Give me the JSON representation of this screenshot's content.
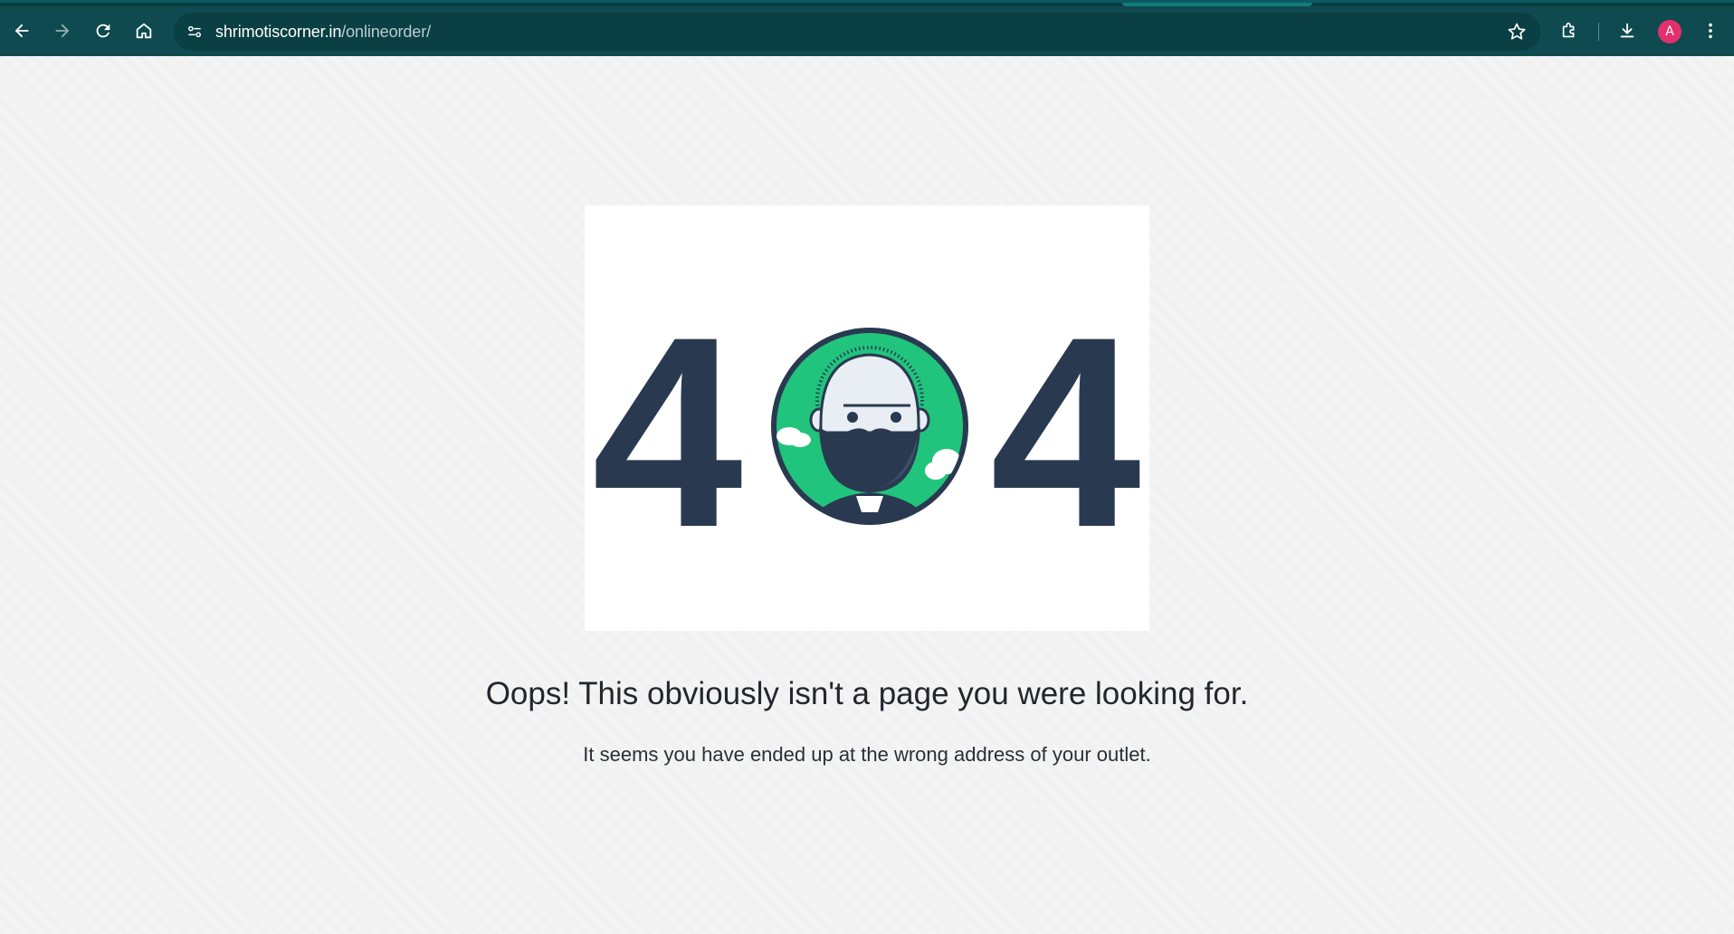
{
  "browser": {
    "url_domain": "shrimotiscorner.in",
    "url_path": "/onlineorder/",
    "profile_initial": "A",
    "accent_color": "#0e4a4f",
    "profile_color": "#e3306c",
    "icons": [
      "back-icon",
      "forward-icon",
      "reload-icon",
      "home-icon",
      "site-info-icon",
      "bookmark-star-icon",
      "extensions-icon",
      "download-icon",
      "more-menu-icon"
    ]
  },
  "error_page": {
    "digit_left": "4",
    "digit_right": "4",
    "headline": "Oops! This obviously isn't a page you were looking for.",
    "subline": "It seems you have ended up at the wrong address of your outlet.",
    "digit_color": "#293a50",
    "badge_color": "#21c47d"
  }
}
